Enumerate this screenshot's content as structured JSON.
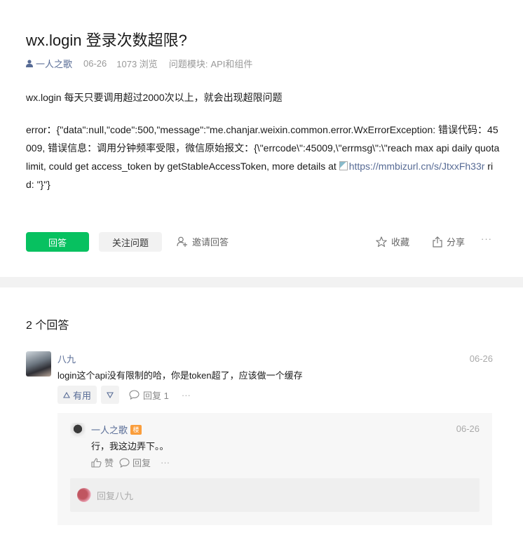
{
  "question": {
    "title": "wx.login 登录次数超限?",
    "author": "一人之歌",
    "date": "06-26",
    "views": "1073 浏览",
    "module_label": "问题模块:",
    "module_value": "API和组件",
    "line1": "wx.login 每天只要调用超过2000次以上，就会出现超限问题",
    "error_text": "error：{\"data\":null,\"code\":500,\"message\":\"me.chanjar.weixin.common.error.WxErrorException: 错误代码：45009, 错误信息：调用分钟频率受限，微信原始报文：{\\\"errcode\\\":45009,\\\"errmsg\\\":\\\"reach max api daily quota limit, could get access_token by getStableAccessToken, more details at ",
    "link_text": "https://mmbizurl.cn/s/JtxxFh33r",
    "error_tail": " rid: \"}\"}"
  },
  "actions": {
    "answer": "回答",
    "follow": "关注问题",
    "invite": "邀请回答",
    "favorite": "收藏",
    "share": "分享",
    "more": "···"
  },
  "answers": {
    "count_label": "2 个回答",
    "items": [
      {
        "name": "八九",
        "date": "06-26",
        "text": "login这个api没有限制的哈，你是token超了，应该做一个缓存",
        "useful_label": "有用",
        "reply_label": "回复 1",
        "more": "···"
      }
    ],
    "sub_reply": {
      "name": "一人之歌",
      "badge": "楼",
      "date": "06-26",
      "text": "行，我这边弄下。。",
      "like_label": "赞",
      "reply_label": "回复",
      "more": "···",
      "input_placeholder": "回复八九"
    }
  }
}
